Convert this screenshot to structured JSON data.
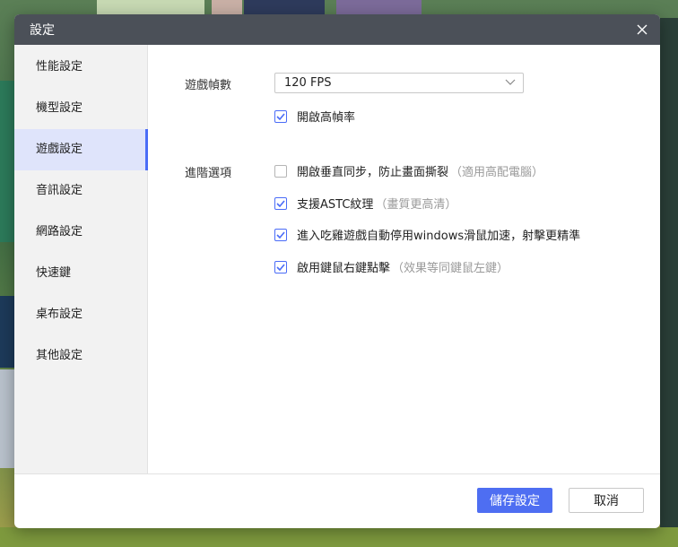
{
  "dialog": {
    "title": "設定"
  },
  "sidebar": {
    "items": [
      {
        "label": "性能設定",
        "active": false
      },
      {
        "label": "機型設定",
        "active": false
      },
      {
        "label": "遊戲設定",
        "active": true
      },
      {
        "label": "音訊設定",
        "active": false
      },
      {
        "label": "網路設定",
        "active": false
      },
      {
        "label": "快速鍵",
        "active": false
      },
      {
        "label": "桌布設定",
        "active": false
      },
      {
        "label": "其他設定",
        "active": false
      }
    ]
  },
  "game": {
    "fps_label": "遊戲幀數",
    "fps_value": "120 FPS",
    "high_fps": {
      "label": "開啟高幀率",
      "checked": true
    },
    "advanced_label": "進階選項",
    "advanced": [
      {
        "label": "開啟垂直同步，防止畫面撕裂",
        "hint": "（適用高配電腦）",
        "checked": false
      },
      {
        "label": "支援ASTC紋理",
        "hint": "（畫質更高清）",
        "checked": true
      },
      {
        "label": "進入吃雞遊戲自動停用windows滑鼠加速，射擊更精準",
        "hint": "",
        "checked": true
      },
      {
        "label": "啟用鍵鼠右鍵點擊",
        "hint": "（效果等同鍵鼠左鍵）",
        "checked": true
      }
    ]
  },
  "footer": {
    "save_label": "儲存設定",
    "cancel_label": "取消"
  },
  "colors": {
    "accent": "#4e6ef2",
    "titlebar": "#4b5058",
    "active_nav_bg": "#dfe4fb"
  }
}
